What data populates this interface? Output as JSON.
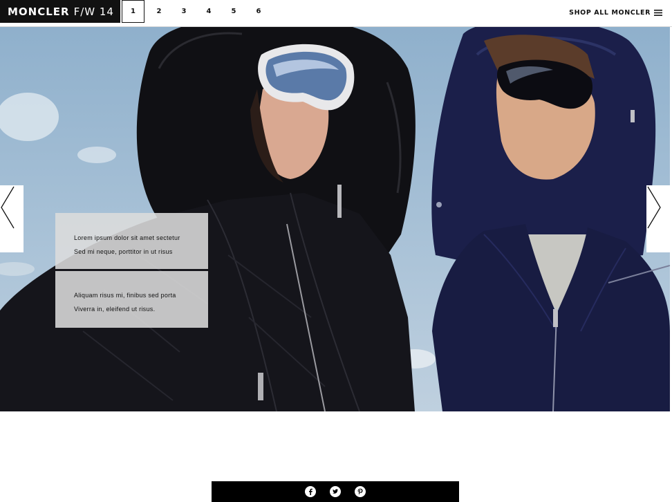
{
  "header": {
    "brand_strong": "MONCLER",
    "brand_light": "F/W 14",
    "pages": [
      "1",
      "2",
      "3",
      "4",
      "5",
      "6"
    ],
    "active_page": "1",
    "shop_all_label": "SHOP ALL MONCLER",
    "menu_icon": "hamburger-menu-icon"
  },
  "hero": {
    "prev_icon": "chevron-left-icon",
    "next_icon": "chevron-right-icon",
    "captions": [
      {
        "line1": "Lorem ipsum dolor sit amet sectetur",
        "line2": "Sed mi neque, porttitor in ut risus"
      },
      {
        "line1": "Aliquam risus mi, finibus sed porta",
        "line2": "Viverra in, eleifend ut risus."
      }
    ]
  },
  "share": {
    "icons": [
      "facebook-icon",
      "twitter-icon",
      "pinterest-icon"
    ]
  },
  "colors": {
    "brand_bg": "#111111",
    "sky": "#a9c2d7",
    "jacket_black": "#15151b",
    "jacket_navy": "#1b1f4a",
    "caption_bg": "#dcdcdc"
  }
}
